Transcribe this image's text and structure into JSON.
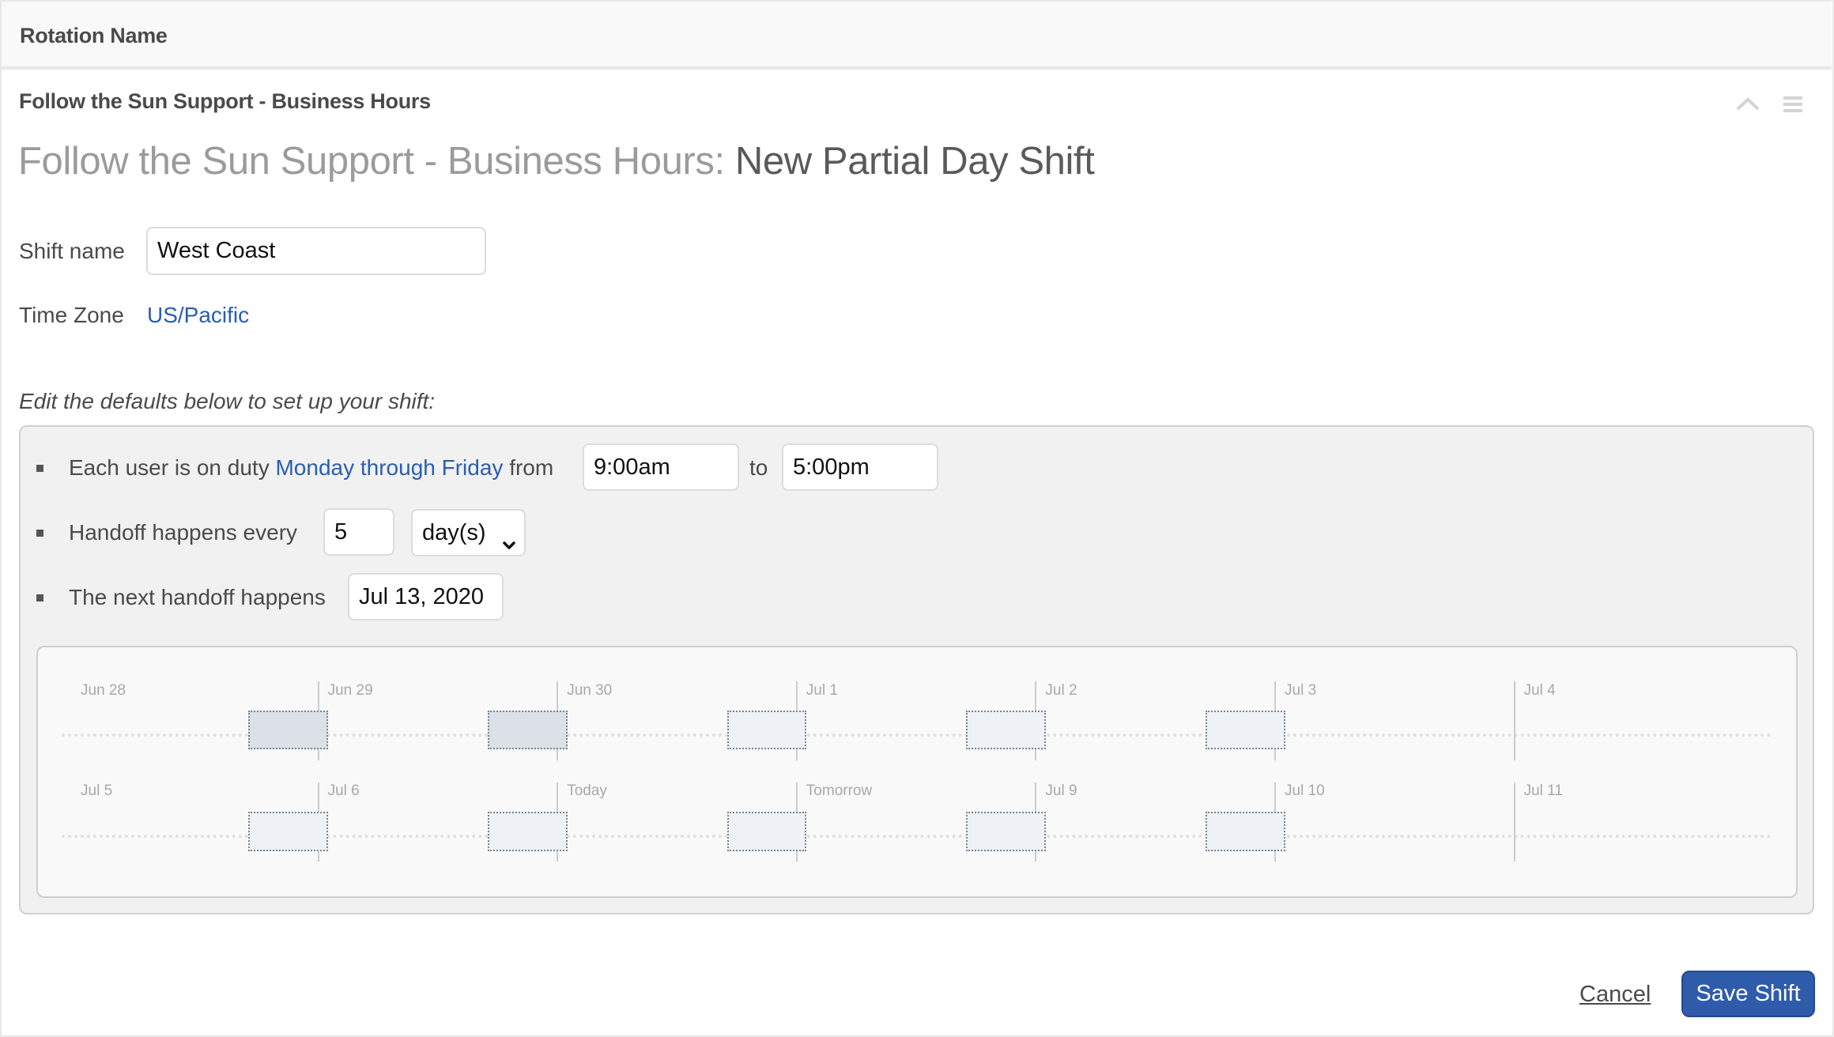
{
  "header": {
    "title": "Rotation Name"
  },
  "rotation": {
    "name": "Follow the Sun Support - Business Hours",
    "title_prefix": "Follow the Sun Support - Business Hours:",
    "title_suffix": "New Partial Day Shift",
    "icons": {
      "collapse": "chevron-up-icon",
      "menu": "hamburger-menu-icon"
    }
  },
  "form": {
    "shift_name_label": "Shift name",
    "shift_name_value": "West Coast",
    "time_zone_label": "Time Zone",
    "time_zone_value": "US/Pacific",
    "defaults_note": "Edit the defaults below to set up your shift:",
    "row1": {
      "prefix": "Each user is on duty",
      "days_link": "Monday through Friday",
      "from": "from",
      "start_time": "9:00am",
      "to": "to",
      "end_time": "5:00pm"
    },
    "row2": {
      "prefix": "Handoff happens every",
      "interval": "5",
      "unit": "day(s)",
      "unit_options": [
        "day(s)"
      ]
    },
    "row3": {
      "prefix": "The next handoff happens",
      "date": "Jul 13, 2020"
    }
  },
  "calendar": {
    "weeks": [
      {
        "days": [
          "Jun 28",
          "Jun 29",
          "Jun 30",
          "Jul 1",
          "Jul 2",
          "Jul 3",
          "Jul 4"
        ]
      },
      {
        "days": [
          "Jul 5",
          "Jul 6",
          "Today",
          "Tomorrow",
          "Jul 9",
          "Jul 10",
          "Jul 11"
        ]
      }
    ],
    "shift_start_hour": 17,
    "shift_duration_hours": 8,
    "shifts": [
      {
        "week": 0,
        "day": 1,
        "past": true
      },
      {
        "week": 0,
        "day": 2,
        "past": true
      },
      {
        "week": 0,
        "day": 3,
        "past": false
      },
      {
        "week": 0,
        "day": 4,
        "past": false
      },
      {
        "week": 0,
        "day": 5,
        "past": false
      },
      {
        "week": 1,
        "day": 1,
        "past": false
      },
      {
        "week": 1,
        "day": 2,
        "past": false
      },
      {
        "week": 1,
        "day": 3,
        "past": false
      },
      {
        "week": 1,
        "day": 4,
        "past": false
      },
      {
        "week": 1,
        "day": 5,
        "past": false
      }
    ],
    "colors": {
      "past_fill": "#dce1e8",
      "future_fill": "#eef2f7",
      "block_border": "#78848f"
    }
  },
  "actions": {
    "cancel": "Cancel",
    "save": "Save Shift"
  },
  "colors": {
    "accent": "#2f5bab",
    "link": "#2a5db0"
  }
}
